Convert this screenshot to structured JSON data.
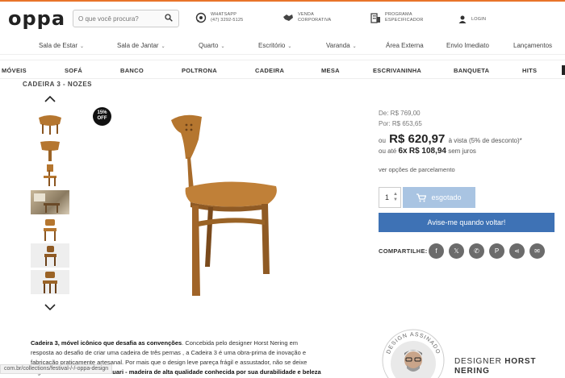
{
  "header": {
    "logo": "oppa",
    "search_placeholder": "O que você procura?",
    "items": [
      {
        "line1": "WHATSAPP",
        "line2": "(47) 3292-5125",
        "icon": "whatsapp-icon"
      },
      {
        "line1": "VENDA",
        "line2": "CORPORATIVA",
        "icon": "handshake-icon"
      },
      {
        "line1": "PROGRAMA",
        "line2": "ESPECIFICADOR",
        "icon": "building-icon"
      },
      {
        "line1": "LOGIN",
        "line2": "",
        "icon": "user-icon"
      }
    ]
  },
  "nav": {
    "categories": [
      {
        "label": "Sala de Estar",
        "chevron": "⌄"
      },
      {
        "label": "Sala de Jantar",
        "chevron": "⌄"
      },
      {
        "label": "Quarto",
        "chevron": "⌄"
      },
      {
        "label": "Escritório",
        "chevron": "⌄"
      },
      {
        "label": "Varanda",
        "chevron": "⌄"
      },
      {
        "label": "Área Externa",
        "chevron": ""
      },
      {
        "label": "Envio Imediato",
        "chevron": ""
      },
      {
        "label": "Lançamentos",
        "chevron": ""
      }
    ],
    "sub": [
      "MÓVEIS",
      "SOFÁ",
      "BANCO",
      "POLTRONA",
      "CADEIRA",
      "MESA",
      "ESCRIVANINHA",
      "BANQUETA",
      "HITS"
    ]
  },
  "breadcrumb": "CADEIRA 3 - NOZES",
  "badge": {
    "line1": "15%",
    "line2": "OFF"
  },
  "price": {
    "de": "De: R$ 769,00",
    "por": "Por: R$ 653,65",
    "prefix": "ou",
    "main": "R$ 620,97",
    "suffix": "à vista (5% de desconto)*",
    "inst_prefix": "ou até",
    "inst_count": "6x",
    "inst_value": "R$ 108,94",
    "inst_suffix": "sem juros",
    "parcel_link": "ver opções de parcelamento"
  },
  "cart": {
    "quantity": "1",
    "soldout_label": "esgotado",
    "notify_label": "Avise-me quando voltar!"
  },
  "share": {
    "label": "COMPARTILHE:",
    "buttons": [
      {
        "name": "facebook-icon",
        "glyph": "f"
      },
      {
        "name": "x-icon",
        "glyph": "𝕏"
      },
      {
        "name": "whatsapp-share-icon",
        "glyph": "✆"
      },
      {
        "name": "pinterest-icon",
        "glyph": "P"
      },
      {
        "name": "share-icon",
        "glyph": "⋖"
      },
      {
        "name": "email-icon",
        "glyph": "✉"
      }
    ]
  },
  "description": {
    "bold_intro": "Cadeira 3, móvel icônico que desafia as convenções",
    "text": ". Concebida pelo designer Horst Nering em resposta ao desafio de criar uma cadeira de três pernas , a Cadeira 3 é uma obra-prima de inovação e fabricação praticamente artesanal. Por mais que o design leve pareça frágil e assustador, não se deixe enganar:",
    "bold_tail": "com estrutura de tauari - madeira de alta qualidade conhecida por sua durabilidade e beleza"
  },
  "status_url": "com.br/collections/festival-/-/-oppa-design",
  "designer": {
    "seal_text": "DESIGN ASSINADO",
    "label": "DESIGNER",
    "first": "HORST",
    "last": "NERING"
  },
  "colors": {
    "accent": "#3e72b5",
    "soldout": "#a9c4e2",
    "wood": "#b5762f",
    "topline": "#e8742a"
  }
}
